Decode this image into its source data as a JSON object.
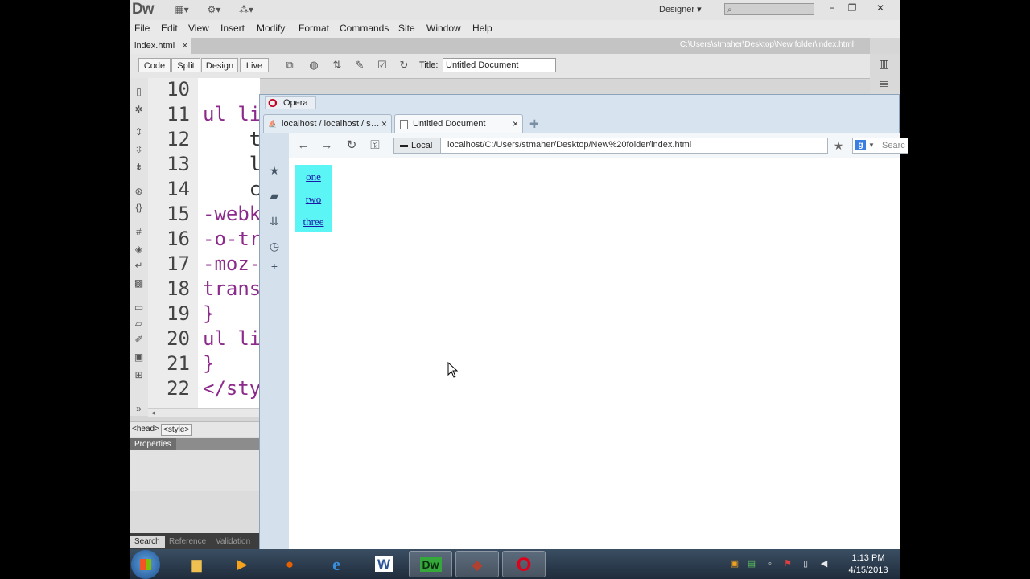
{
  "dreamweaver": {
    "logo": "Dw",
    "workspace": "Designer",
    "menus": [
      "File",
      "Edit",
      "View",
      "Insert",
      "Modify",
      "Format",
      "Commands",
      "Site",
      "Window",
      "Help"
    ],
    "doc_tab": {
      "label": "index.html",
      "close": "×"
    },
    "doc_path": "C:\\Users\\stmaher\\Desktop\\New folder\\index.html",
    "view_buttons": [
      "Code",
      "Split",
      "Design",
      "Live"
    ],
    "title_label": "Title:",
    "title_value": "Untitled Document",
    "line_numbers": [
      "10",
      "11",
      "12",
      "13",
      "14",
      "15",
      "16",
      "17",
      "18",
      "19",
      "20",
      "21",
      "22"
    ],
    "code_lines": [
      "",
      "ul li",
      "    t",
      "    l",
      "    c",
      "-webk",
      "-o-tr",
      "-moz-",
      "trans",
      "}",
      "ul li",
      "}",
      "</sty"
    ],
    "tag_selector": [
      "<head>",
      "<style>"
    ],
    "properties_label": "Properties",
    "results_tabs": [
      "Search",
      "Reference",
      "Validation"
    ]
  },
  "opera": {
    "window_title": "Opera",
    "tabs": [
      {
        "label": "localhost / localhost / s…",
        "close": "×"
      },
      {
        "label": "Untitled Document",
        "close": "×"
      }
    ],
    "address_chip": "Local",
    "url": "localhost/C:/Users/stmaher/Desktop/New%20folder/index.html",
    "search_placeholder": "Searc",
    "nav_box_color": "#5cf5f5",
    "nav_links": [
      "one",
      "two",
      "three"
    ]
  },
  "taskbar": {
    "time": "1:13 PM",
    "date": "4/15/2013",
    "apps": [
      "explorer",
      "media-player",
      "firefox",
      "internet-explorer",
      "word",
      "dreamweaver",
      "app-7",
      "opera"
    ],
    "word_label": "W",
    "dw_label": "Dw"
  }
}
